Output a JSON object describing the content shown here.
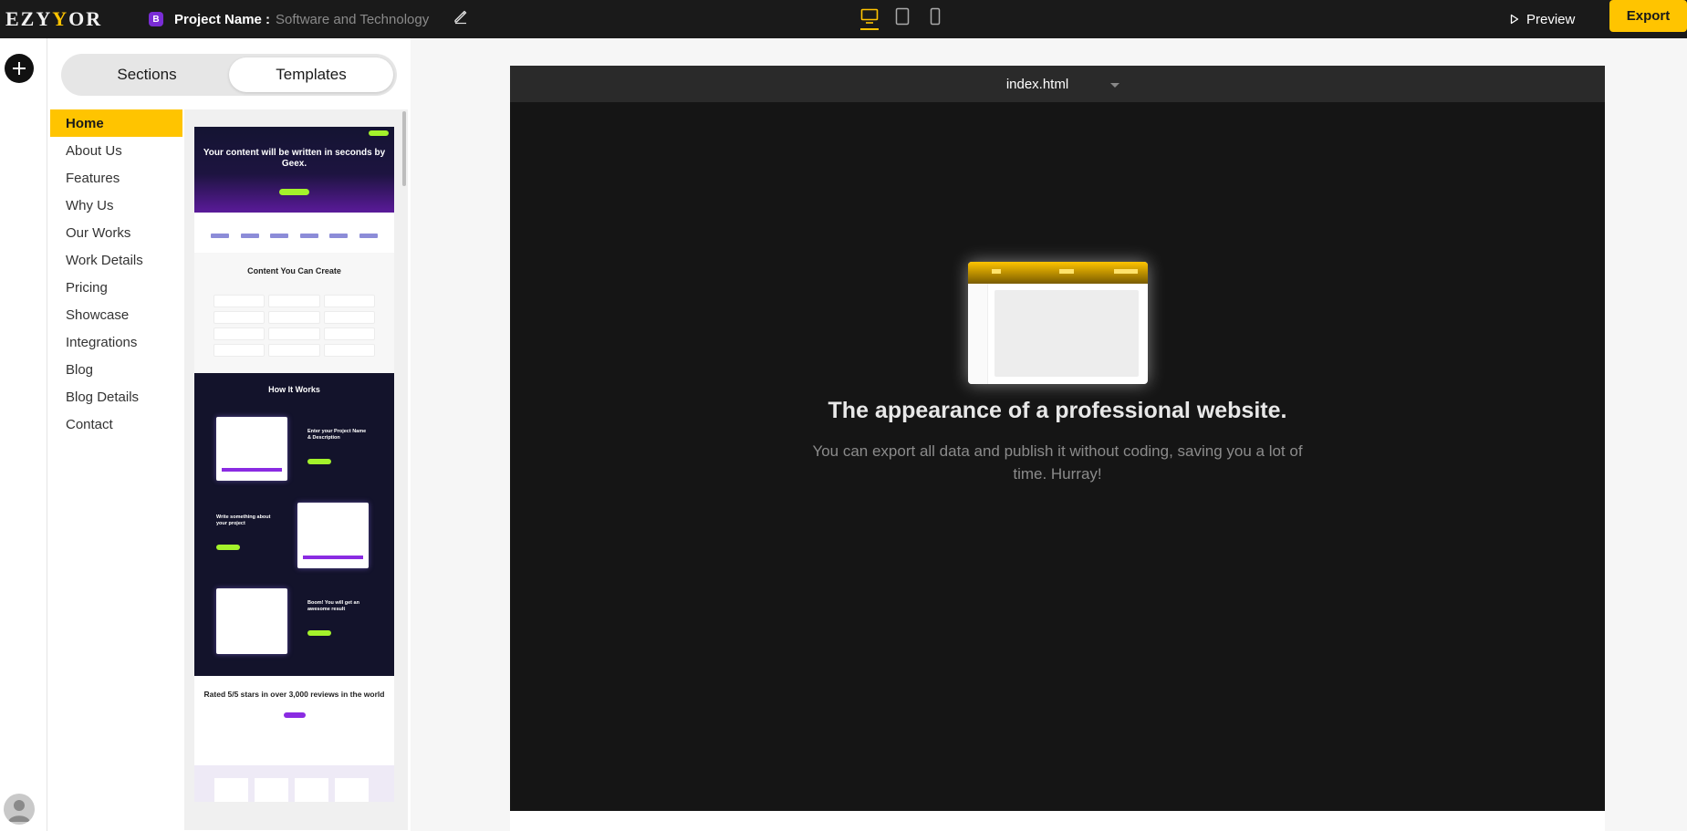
{
  "app": {
    "logo_text_1": "EZY",
    "logo_text_2": "Y",
    "logo_text_3": "OR"
  },
  "header": {
    "project_badge": "B",
    "project_label": "Project Name :",
    "project_name": "Software and Technology",
    "preview_label": "Preview",
    "export_label": "Export",
    "accent": "#ffc400"
  },
  "panel": {
    "tabs": [
      {
        "label": "Sections"
      },
      {
        "label": "Templates"
      }
    ],
    "pages": [
      {
        "label": "Home"
      },
      {
        "label": "About Us"
      },
      {
        "label": "Features"
      },
      {
        "label": "Why Us"
      },
      {
        "label": "Our Works"
      },
      {
        "label": "Work Details"
      },
      {
        "label": "Pricing"
      },
      {
        "label": "Showcase"
      },
      {
        "label": "Integrations"
      },
      {
        "label": "Blog"
      },
      {
        "label": "Blog Details"
      },
      {
        "label": "Contact"
      }
    ]
  },
  "template_preview": {
    "hero_title": "Your content will be written in seconds by Geex.",
    "content_title": "Content You Can Create",
    "how_title": "How It Works",
    "step1": "Enter your Project Name & Description",
    "step2": "Write something about your project",
    "step3": "Boom! You will get an awesome result",
    "rated_title": "Rated 5/5 stars in over 3,000 reviews in the world"
  },
  "canvas": {
    "file_name": "index.html",
    "empty_title": "The appearance of a professional website.",
    "empty_desc": "You can export all data and publish it without coding, saving you a lot of time. Hurray!"
  }
}
